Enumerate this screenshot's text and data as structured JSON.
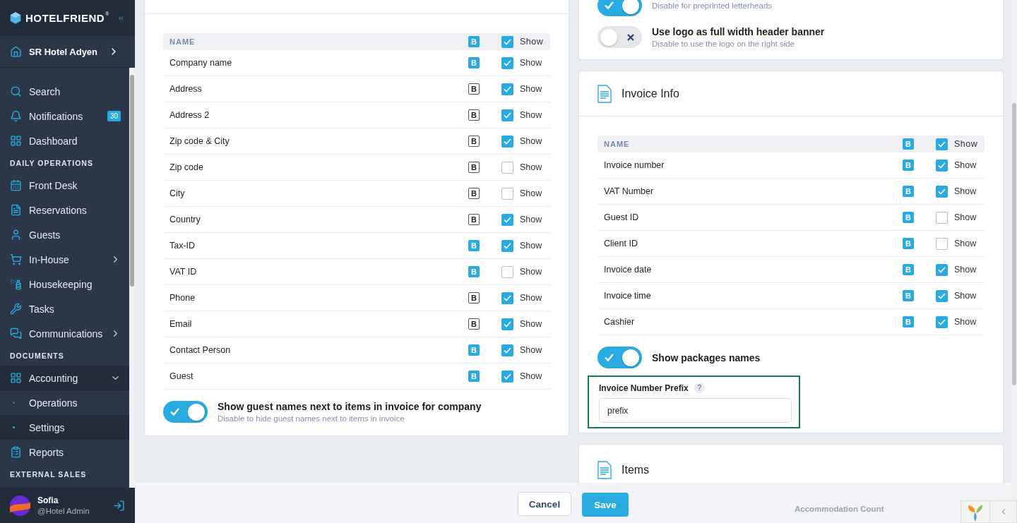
{
  "sidebar": {
    "brand": "HOTELFRIEND",
    "brand_mark": "®",
    "hotel": "SR Hotel Adyen",
    "nav": [
      {
        "kind": "item",
        "label": "Search",
        "selected": false
      },
      {
        "kind": "item",
        "label": "Notifications",
        "badge": "30",
        "selected": false
      },
      {
        "kind": "item",
        "label": "Dashboard",
        "selected": false
      },
      {
        "kind": "heading",
        "label": "DAILY OPERATIONS"
      },
      {
        "kind": "item",
        "label": "Front Desk",
        "selected": false
      },
      {
        "kind": "item",
        "label": "Reservations",
        "selected": false
      },
      {
        "kind": "item",
        "label": "Guests",
        "selected": false
      },
      {
        "kind": "item",
        "label": "In-House",
        "expanded": false,
        "selected": false
      },
      {
        "kind": "item",
        "label": "Housekeeping",
        "selected": false
      },
      {
        "kind": "item",
        "label": "Tasks",
        "selected": false
      },
      {
        "kind": "item",
        "label": "Communications",
        "expanded": false,
        "selected": false
      },
      {
        "kind": "heading",
        "label": "DOCUMENTS"
      },
      {
        "kind": "item",
        "label": "Accounting",
        "expanded": true,
        "selected": true
      },
      {
        "kind": "subitem",
        "label": "Operations",
        "selected": false
      },
      {
        "kind": "subitem",
        "label": "Settings",
        "selected": true
      },
      {
        "kind": "item",
        "label": "Reports",
        "selected": false
      },
      {
        "kind": "heading",
        "label": "EXTERNAL SALES"
      }
    ],
    "user": {
      "name": "Sofia",
      "role": "@Hotel Admin"
    }
  },
  "company_card": {
    "table": {
      "header": {
        "name": "NAME",
        "b": "B",
        "bold": true,
        "checked": true,
        "show": "Show"
      },
      "rows": [
        {
          "name": "Company name",
          "b": "B",
          "bold": true,
          "checked": true,
          "show": "Show"
        },
        {
          "name": "Address",
          "b": "B",
          "bold": false,
          "checked": true,
          "show": "Show"
        },
        {
          "name": "Address 2",
          "b": "B",
          "bold": false,
          "checked": true,
          "show": "Show"
        },
        {
          "name": "Zip code & City",
          "b": "B",
          "bold": false,
          "checked": true,
          "show": "Show"
        },
        {
          "name": "Zip code",
          "b": "B",
          "bold": false,
          "checked": false,
          "show": "Show"
        },
        {
          "name": "City",
          "b": "B",
          "bold": false,
          "checked": false,
          "show": "Show"
        },
        {
          "name": "Country",
          "b": "B",
          "bold": false,
          "checked": true,
          "show": "Show"
        },
        {
          "name": "Tax-ID",
          "b": "B",
          "bold": true,
          "checked": true,
          "show": "Show"
        },
        {
          "name": "VAT ID",
          "b": "B",
          "bold": true,
          "checked": false,
          "show": "Show"
        },
        {
          "name": "Phone",
          "b": "B",
          "bold": false,
          "checked": true,
          "show": "Show"
        },
        {
          "name": "Email",
          "b": "B",
          "bold": false,
          "checked": true,
          "show": "Show"
        },
        {
          "name": "Contact Person",
          "b": "B",
          "bold": true,
          "checked": true,
          "show": "Show"
        },
        {
          "name": "Guest",
          "b": "B",
          "bold": true,
          "checked": true,
          "show": "Show"
        }
      ]
    },
    "toggle": {
      "title": "Show guest names next to items in invoice for company",
      "subtitle": "Disable to hide guest names next to items in invoice",
      "on": true
    }
  },
  "header_card": {
    "toggles": [
      {
        "subtitle": "Disable for preprinted letterheads",
        "on": true
      },
      {
        "title": "Use logo as full width header banner",
        "subtitle": "Disable to use the logo on the right side",
        "on": false
      }
    ]
  },
  "invoice_info": {
    "title": "Invoice Info",
    "table": {
      "header": {
        "name": "NAME",
        "b": "B",
        "bold": true,
        "checked": true,
        "show": "Show"
      },
      "rows": [
        {
          "name": "Invoice number",
          "b": "B",
          "bold": true,
          "checked": true,
          "show": "Show"
        },
        {
          "name": "VAT Number",
          "b": "B",
          "bold": true,
          "checked": true,
          "show": "Show"
        },
        {
          "name": "Guest ID",
          "b": "B",
          "bold": true,
          "checked": false,
          "show": "Show"
        },
        {
          "name": "Client ID",
          "b": "B",
          "bold": true,
          "checked": false,
          "show": "Show"
        },
        {
          "name": "Invoice date",
          "b": "B",
          "bold": true,
          "checked": true,
          "show": "Show"
        },
        {
          "name": "Invoice time",
          "b": "B",
          "bold": true,
          "checked": true,
          "show": "Show"
        },
        {
          "name": "Cashier",
          "b": "B",
          "bold": true,
          "checked": true,
          "show": "Show"
        }
      ]
    },
    "toggle": {
      "title": "Show packages names",
      "on": true
    },
    "prefix_field": {
      "label": "Invoice Number Prefix",
      "help": "?",
      "value": "prefix",
      "highlighted": true
    }
  },
  "items_card": {
    "title": "Items"
  },
  "footer": {
    "cancel": "Cancel",
    "save": "Save",
    "behind_label": "Accommodation Count"
  }
}
